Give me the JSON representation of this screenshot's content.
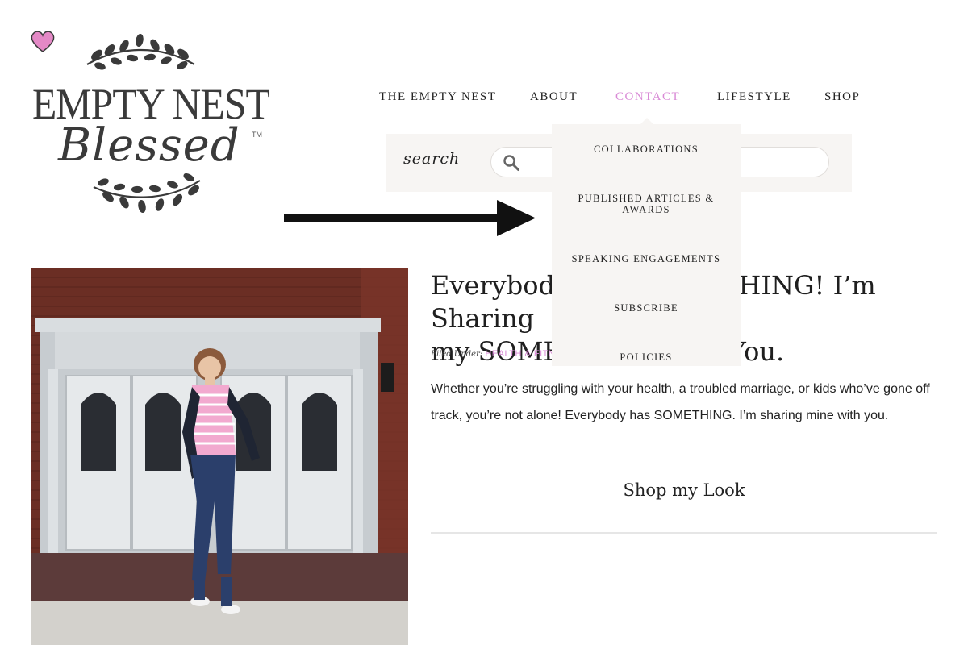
{
  "logo": {
    "line1": "EMPTY NEST",
    "line2": "Blessed",
    "trademark": "TM",
    "heart_color": "#e489c6",
    "ink_color": "#3a3a3a"
  },
  "nav": {
    "items": [
      {
        "label": "THE EMPTY NEST",
        "active": false
      },
      {
        "label": "ABOUT",
        "active": false
      },
      {
        "label": "CONTACT",
        "active": true
      },
      {
        "label": "LIFESTYLE",
        "active": false
      },
      {
        "label": "SHOP",
        "active": false
      }
    ]
  },
  "search": {
    "label": "search",
    "icon": "search-icon"
  },
  "dropdown": {
    "items": [
      {
        "label": "COLLABORATIONS"
      },
      {
        "label": "PUBLISHED ARTICLES &"
      },
      {
        "label": "AWARDS"
      },
      {
        "label": "SPEAKING ENGAGEMENTS"
      },
      {
        "label": "SUBSCRIBE"
      },
      {
        "label": "POLICIES"
      }
    ]
  },
  "annotation": {
    "icon": "right-arrow-icon"
  },
  "post": {
    "title_line1": "Everybody Has SOMETHING! I’m Sharing",
    "title_line2": "my SOMETHING with You.",
    "filed_label": "Filed Under:",
    "category": "HEALTH & FITNESS",
    "excerpt": "Whether you’re struggling with your health, a troubled marriage, or kids who’ve gone off track, you’re not alone! Everybody has SOMETHING. I’m sharing mine with you.",
    "shop_heading": "Shop my Look"
  },
  "colors": {
    "accent": "#d98ad6",
    "panel": "#f7f5f3",
    "text": "#222222"
  }
}
